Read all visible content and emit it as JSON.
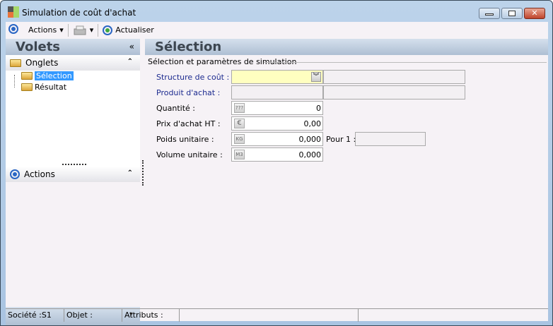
{
  "window": {
    "title": "Simulation de coût d'achat",
    "close_glyph": "✕"
  },
  "toolbar": {
    "actions": "Actions",
    "refresh": "Actualiser"
  },
  "left": {
    "header": "Volets",
    "collapse": "«",
    "onglets": "Onglets",
    "tree": [
      "Sélection",
      "Résultat"
    ],
    "actions": "Actions",
    "chevron_up": "⌃",
    "scroll_down": "▾"
  },
  "main": {
    "header": "Sélection",
    "group": "Sélection et paramètres de simulation",
    "fields": [
      {
        "label": "Structure de coût :",
        "value": ""
      },
      {
        "label": "Produit d'achat :",
        "value": ""
      },
      {
        "label": "Quantité :",
        "value": "0",
        "unit": "???"
      },
      {
        "label": "Prix d'achat HT :",
        "value": "0,00",
        "unit": "€"
      },
      {
        "label": "Poids unitaire :",
        "value": "0,000",
        "unit": "KG"
      },
      {
        "label": "Volume unitaire :",
        "value": "0,000",
        "unit": "M3"
      }
    ],
    "pour": "Pour 1 :",
    "pour_value": ""
  },
  "status": {
    "societe": "Société :S1",
    "objet": "Objet :",
    "attributs": "Attributs :"
  },
  "colors": {
    "selection": "#3399ff",
    "required_field": "#ffffc0",
    "label_blue": "#1c2a8f"
  }
}
